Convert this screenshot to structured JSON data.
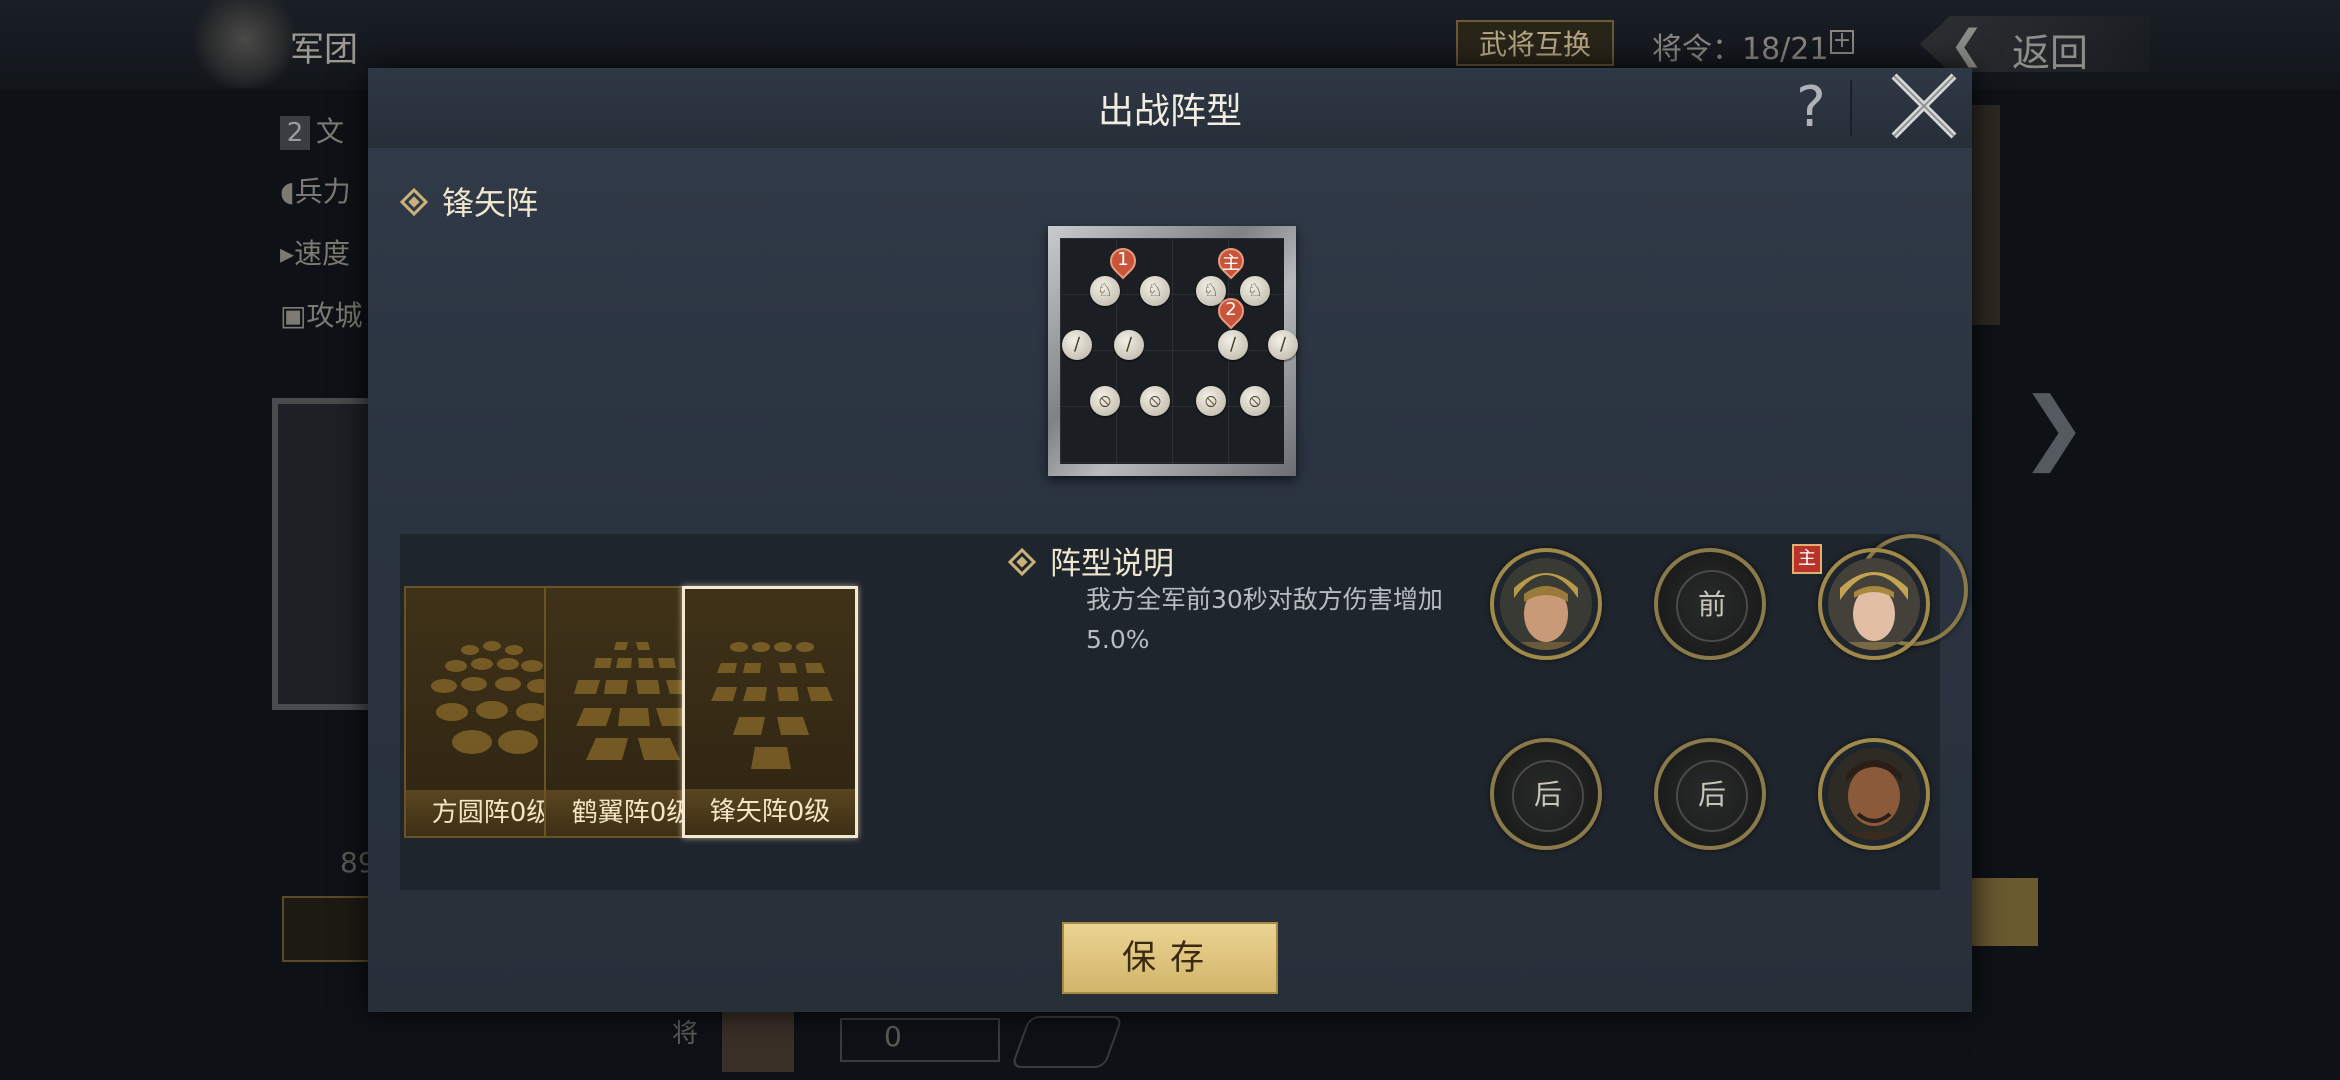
{
  "background": {
    "title": "军团",
    "swap_button": "武将互换",
    "orders": "将令：18/21",
    "plus": "+",
    "back_button": "返回",
    "side_badge": "2",
    "side_name": "文",
    "side_stats": [
      "兵力",
      "速度",
      "攻城"
    ],
    "number": "89",
    "bottom_label": "将",
    "bottom_field_value": "0"
  },
  "dialog": {
    "title": "出战阵型",
    "help": "?",
    "formation_name": "锋矢阵",
    "board_markers": [
      "1",
      "主",
      "2"
    ],
    "cards": [
      {
        "label": "方圆阵0级",
        "selected": false
      },
      {
        "label": "鹤翼阵0级",
        "selected": false
      },
      {
        "label": "锋矢阵0级",
        "selected": true
      }
    ],
    "description_title": "阵型说明",
    "description_text": "我方全军前30秒对敌方伤害增加5.0%",
    "slots": [
      {
        "type": "general",
        "name": "general-1"
      },
      {
        "type": "empty",
        "label": "前"
      },
      {
        "type": "general",
        "name": "general-leader",
        "badge": "主"
      },
      {
        "type": "empty",
        "label": "后"
      },
      {
        "type": "empty",
        "label": "后"
      },
      {
        "type": "general",
        "name": "general-3"
      }
    ],
    "save_button": "保存"
  },
  "colors": {
    "accent_gold": "#d1b56a",
    "panel_bg": "#2b3441",
    "marker_red": "#c8553a"
  }
}
